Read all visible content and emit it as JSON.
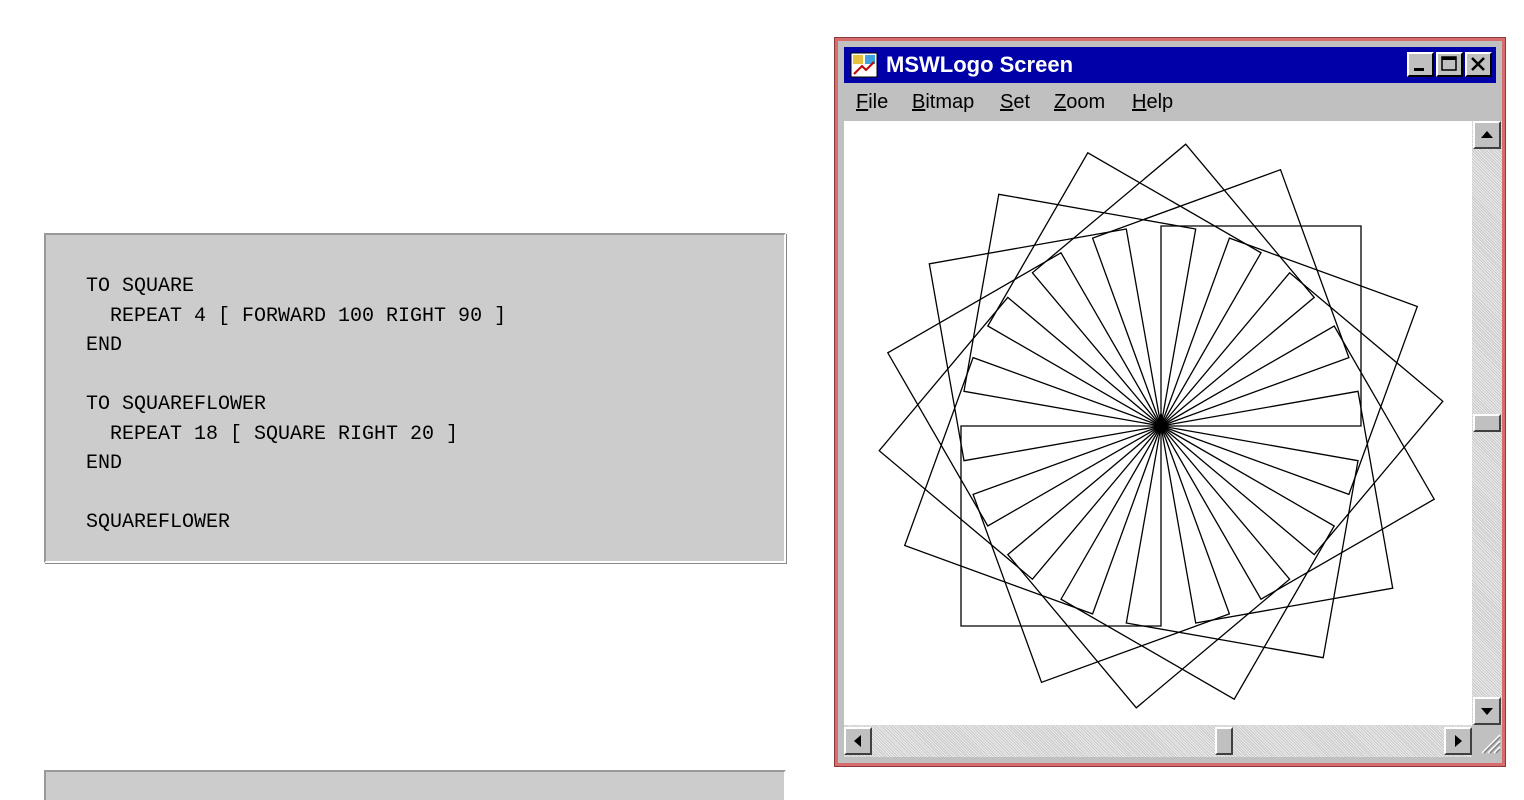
{
  "code": {
    "lines": [
      "TO SQUARE",
      "  REPEAT 4 [ FORWARD 100 RIGHT 90 ]",
      "END",
      "",
      "TO SQUAREFLOWER",
      "  REPEAT 18 [ SQUARE RIGHT 20 ]",
      "END",
      "",
      "SQUAREFLOWER"
    ]
  },
  "window": {
    "title": "MSWLogo Screen",
    "menu": [
      {
        "label": "File",
        "accel": "F",
        "rest": "ile"
      },
      {
        "label": "Bitmap",
        "accel": "B",
        "rest": "itmap"
      },
      {
        "label": "Set",
        "accel": "S",
        "rest": "et"
      },
      {
        "label": "Zoom",
        "accel": "Z",
        "rest": "oom"
      },
      {
        "label": "Help",
        "accel": "H",
        "rest": "elp"
      }
    ],
    "drawing": {
      "squares": 18,
      "turn_degrees": 20,
      "side_length": 100
    },
    "scroll": {
      "vertical_position": 0.5,
      "horizontal_position": 0.62
    }
  },
  "colors": {
    "title_bar": "#0000a8",
    "window_frame": "#d86b6b",
    "code_background": "#cccccc"
  }
}
